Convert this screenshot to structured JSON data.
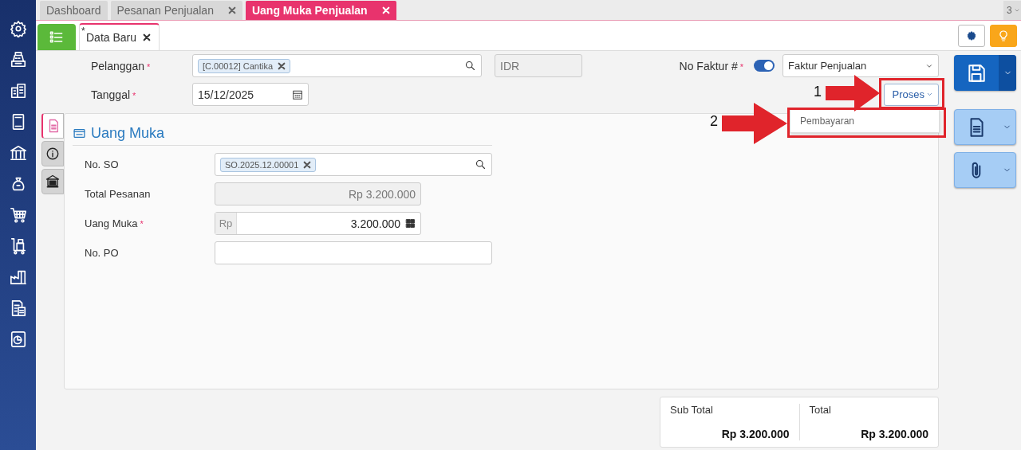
{
  "tabs": [
    {
      "label": "Dashboard",
      "closable": false,
      "selected": false
    },
    {
      "label": "Pesanan Penjualan",
      "closable": true,
      "selected": false
    },
    {
      "label": "Uang Muka Penjualan",
      "closable": true,
      "selected": true
    }
  ],
  "tab_overflow": {
    "count": "3"
  },
  "document_tabs": [
    {
      "label": "Data Baru",
      "modified_mark": "*",
      "selected": true
    }
  ],
  "header": {
    "customer": {
      "label": "Pelanggan",
      "required_mark": "*",
      "tag": "[C.00012] Cantika"
    },
    "currency": {
      "value": "IDR"
    },
    "invoice_no": {
      "label": "No Faktur #",
      "required_mark": "*",
      "auto_number": true,
      "value": "Faktur Penjualan"
    },
    "date": {
      "label": "Tanggal",
      "required_mark": "*",
      "value": "15/12/2025"
    },
    "process_button": {
      "label": "Proses"
    },
    "process_menu": [
      {
        "label": "Pembayaran"
      }
    ]
  },
  "side_tabs": [
    {
      "kind": "document",
      "selected": true
    },
    {
      "kind": "info",
      "selected": false
    },
    {
      "kind": "bank",
      "selected": false
    }
  ],
  "section": {
    "title": "Uang Muka",
    "fields": [
      {
        "kind": "tag-search",
        "label": "No. SO",
        "tag": "SO.2025.12.00001"
      },
      {
        "kind": "readonly",
        "label": "Total Pesanan",
        "value": "Rp 3.200.000"
      },
      {
        "kind": "currency",
        "label": "Uang Muka",
        "required_mark": "*",
        "prefix": "Rp",
        "value": "3.200.000"
      },
      {
        "kind": "text",
        "label": "No. PO"
      }
    ]
  },
  "totals": [
    {
      "label": "Sub Total",
      "value": "Rp 3.200.000"
    },
    {
      "label": "Total",
      "value": "Rp 3.200.000"
    }
  ],
  "annotations": [
    {
      "number": "1"
    },
    {
      "number": "2"
    }
  ]
}
